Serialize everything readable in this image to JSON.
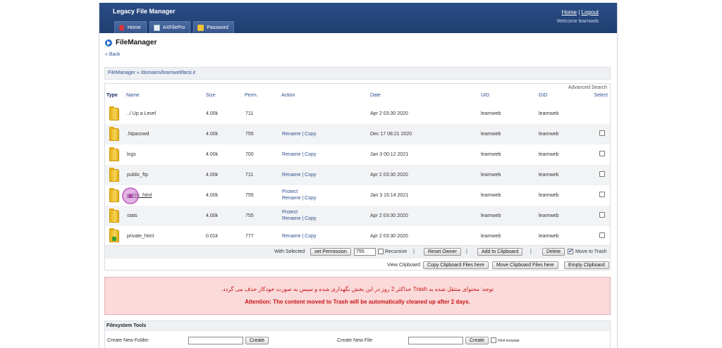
{
  "header": {
    "app_title": "Legacy File Manager",
    "links": {
      "home": "Home",
      "sep": "|",
      "logout": "Logout"
    },
    "welcome": "Welcome learnweb",
    "tabs": [
      {
        "label": "Home",
        "icon": "home-icon"
      },
      {
        "label": "AXFilePro",
        "icon": "document-icon"
      },
      {
        "label": "Password",
        "icon": "key-icon"
      }
    ]
  },
  "page": {
    "title": "FileManager",
    "back": "« Back",
    "breadcrumb": "FileManager » /domains/learnwebfarsi.ir"
  },
  "table": {
    "advanced_search": "Advanced Search",
    "columns": {
      "type": "Type",
      "name": "Name",
      "size": "Size",
      "perm": "Perm.",
      "action": "Action",
      "date": "Date",
      "uid": "UID",
      "gid": "GID",
      "select": "Select"
    },
    "rows": [
      {
        "name": "../ Up a Level",
        "size": "4.00k",
        "perm": "711",
        "action1": "",
        "action2": "",
        "date": "Apr 2 03:30 2020",
        "uid": "learnweb",
        "gid": "learnweb",
        "checkbox": false
      },
      {
        "name": ".htpasswd",
        "size": "4.00k",
        "perm": "755",
        "action1": "",
        "action2": "Rename | Copy",
        "date": "Dec 17 08:21 2020",
        "uid": "learnweb",
        "gid": "learnweb",
        "checkbox": true
      },
      {
        "name": "logs",
        "size": "4.00k",
        "perm": "700",
        "action1": "",
        "action2": "Rename | Copy",
        "date": "Jan 3 00:12 2021",
        "uid": "learnweb",
        "gid": "learnweb",
        "checkbox": true
      },
      {
        "name": "public_ftp",
        "size": "4.00k",
        "perm": "711",
        "action1": "",
        "action2": "Rename | Copy",
        "date": "Apr 2 03:30 2020",
        "uid": "learnweb",
        "gid": "learnweb",
        "checkbox": true
      },
      {
        "name": "public_html",
        "size": "4.00k",
        "perm": "755",
        "action1": "Protect",
        "action2": "Rename | Copy",
        "date": "Jan 3 15:14 2021",
        "uid": "learnweb",
        "gid": "learnweb",
        "checkbox": true
      },
      {
        "name": "stats",
        "size": "4.00k",
        "perm": "755",
        "action1": "Protect",
        "action2": "Rename | Copy",
        "date": "Apr 2 03:30 2020",
        "uid": "learnweb",
        "gid": "learnweb",
        "checkbox": true
      },
      {
        "name": "private_html",
        "size": "0.01k",
        "perm": "777",
        "action1": "",
        "action2": "Rename | Copy",
        "date": "Apr 2 03:30 2020",
        "uid": "learnweb",
        "gid": "learnweb",
        "checkbox": true
      }
    ]
  },
  "actions": {
    "with_selected": "With Selected",
    "set_permission": "set Permission",
    "permission_value": "755",
    "recursive": "Recursive",
    "reset_owner": "Reset Owner",
    "add_clipboard": "Add to Clipboard",
    "delete": "Delete",
    "move_to_trash": "Move to Trash",
    "sep": "|"
  },
  "clipboard": {
    "view": "View Clipboard",
    "copy": "Copy Clipboard Files here",
    "move": "Move Clipboard Files here",
    "empty": "Empty Clipboard"
  },
  "alert": {
    "persian": "توجه: محتوای منتقل شده به Trash حداکثر 2 روز در این بخش نگهداری شده و سپس به صورت خودکار حذف می گردد.",
    "english": "Attention: The content moved to Trash will be automatically cleaned up after 2 days."
  },
  "fs_tools": {
    "title": "Filesystem Tools",
    "new_folder": "Create New Folder",
    "new_file": "Create New File",
    "create": "Create",
    "html_template": "Html template"
  }
}
